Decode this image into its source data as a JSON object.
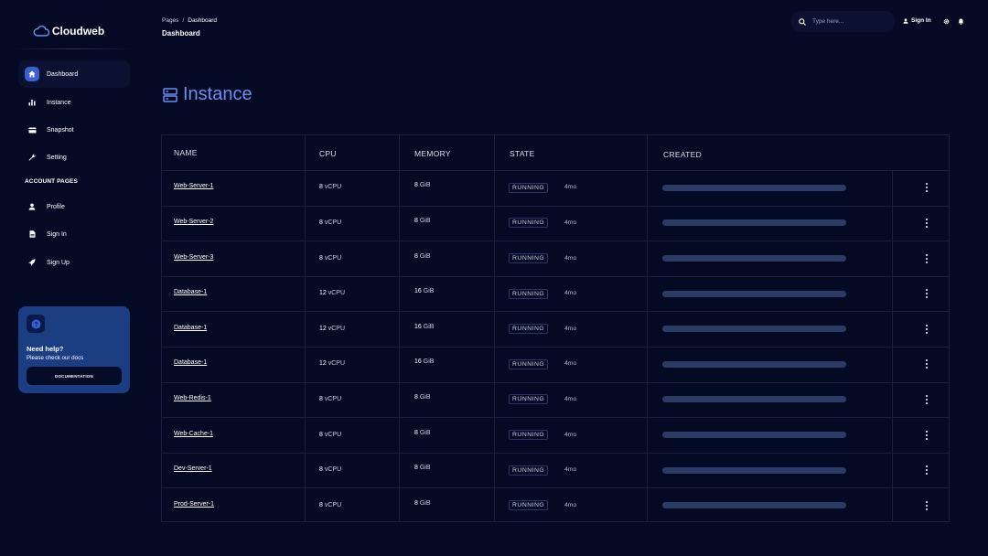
{
  "brand": {
    "name": "Cloudweb"
  },
  "sidebar": {
    "items": [
      {
        "label": "Dashboard",
        "icon": "home-icon",
        "active": true
      },
      {
        "label": "Instance",
        "icon": "bar-chart-icon",
        "active": false
      },
      {
        "label": "Snapshot",
        "icon": "card-icon",
        "active": false
      },
      {
        "label": "Setting",
        "icon": "wrench-icon",
        "active": false
      }
    ],
    "account_heading": "ACCOUNT PAGES",
    "account_items": [
      {
        "label": "Profile",
        "icon": "user-icon"
      },
      {
        "label": "Sign In",
        "icon": "document-icon"
      },
      {
        "label": "Sign Up",
        "icon": "rocket-icon"
      }
    ],
    "help": {
      "title": "Need help?",
      "subtitle": "Please check our docs",
      "button": "DOCUMENTATION"
    }
  },
  "navbar": {
    "breadcrumb_root": "Pages",
    "breadcrumb_sep": "/",
    "breadcrumb_current": "Dashboard",
    "page_title": "Dashboard",
    "search_placeholder": "Type here...",
    "sign_in": "Sign In"
  },
  "main": {
    "heading": "Instance",
    "table": {
      "columns": [
        "NAME",
        "CPU",
        "MEMORY",
        "STATE",
        "CREATED"
      ],
      "rows": [
        {
          "name": "Web-Server-1",
          "cpu": "8",
          "cpu_unit": "vCPU",
          "memory": "8",
          "memory_unit": "GiB",
          "state": "RUNNING",
          "age": "4mo",
          "progress": 1.0
        },
        {
          "name": "Web-Server-2",
          "cpu": "8",
          "cpu_unit": "vCPU",
          "memory": "8",
          "memory_unit": "GiB",
          "state": "RUNNING",
          "age": "4mo",
          "progress": 1.0
        },
        {
          "name": "Web-Server-3",
          "cpu": "8",
          "cpu_unit": "vCPU",
          "memory": "8",
          "memory_unit": "GiB",
          "state": "RUNNING",
          "age": "4mo",
          "progress": 1.0
        },
        {
          "name": "Database-1",
          "cpu": "12",
          "cpu_unit": "vCPU",
          "memory": "16",
          "memory_unit": "GiB",
          "state": "RUNNING",
          "age": "4mo",
          "progress": 1.0
        },
        {
          "name": "Database-1",
          "cpu": "12",
          "cpu_unit": "vCPU",
          "memory": "16",
          "memory_unit": "GiB",
          "state": "RUNNING",
          "age": "4mo",
          "progress": 1.0
        },
        {
          "name": "Database-1",
          "cpu": "12",
          "cpu_unit": "vCPU",
          "memory": "16",
          "memory_unit": "GiB",
          "state": "RUNNING",
          "age": "4mo",
          "progress": 1.0
        },
        {
          "name": "Web-Redis-1",
          "cpu": "8",
          "cpu_unit": "vCPU",
          "memory": "8",
          "memory_unit": "GiB",
          "state": "RUNNING",
          "age": "4mo",
          "progress": 1.0
        },
        {
          "name": "Web-Cache-1",
          "cpu": "8",
          "cpu_unit": "vCPU",
          "memory": "8",
          "memory_unit": "GiB",
          "state": "RUNNING",
          "age": "4mo",
          "progress": 1.0
        },
        {
          "name": "Dev-Server-1",
          "cpu": "8",
          "cpu_unit": "vCPU",
          "memory": "8",
          "memory_unit": "GiB",
          "state": "RUNNING",
          "age": "4mo",
          "progress": 1.0
        },
        {
          "name": "Prod-Server-1",
          "cpu": "8",
          "cpu_unit": "vCPU",
          "memory": "8",
          "memory_unit": "GiB",
          "state": "RUNNING",
          "age": "4mo",
          "progress": 1.0
        }
      ]
    }
  },
  "colors": {
    "background": "#050a24",
    "accent": "#6b8ef0",
    "active_icon": "#3a5fd0",
    "help_card": "#1b3d82"
  }
}
